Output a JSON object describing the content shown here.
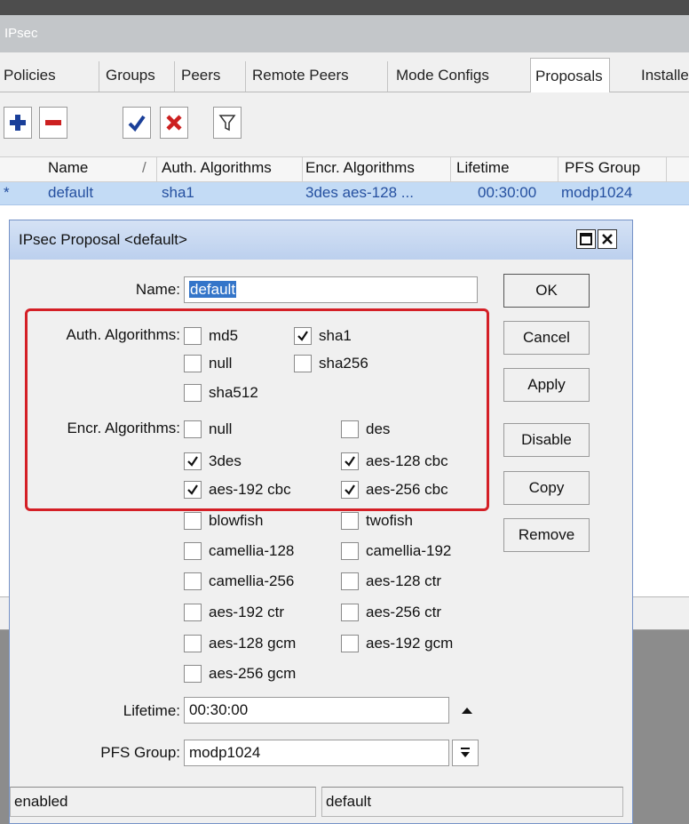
{
  "window": {
    "title": "IPsec"
  },
  "tabs": [
    {
      "label": "Policies"
    },
    {
      "label": "Groups"
    },
    {
      "label": "Peers"
    },
    {
      "label": "Remote Peers"
    },
    {
      "label": "Mode Configs"
    },
    {
      "label": "Proposals"
    },
    {
      "label": "Installe"
    }
  ],
  "active_tab": "Proposals",
  "table": {
    "columns": [
      "Name",
      "Auth. Algorithms",
      "Encr. Algorithms",
      "Lifetime",
      "PFS Group"
    ],
    "sort_marker": "/",
    "rows": [
      {
        "marker": "*",
        "name": "default",
        "auth": "sha1",
        "encr": "3des aes-128 ...",
        "lifetime": "00:30:00",
        "pfs": "modp1024"
      }
    ]
  },
  "dialog": {
    "title": "IPsec Proposal <default>",
    "name_label": "Name:",
    "name_value": "default",
    "auth_label": "Auth. Algorithms:",
    "auth": [
      {
        "label": "md5",
        "checked": false
      },
      {
        "label": "sha1",
        "checked": true
      },
      {
        "label": "null",
        "checked": false
      },
      {
        "label": "sha256",
        "checked": false
      },
      {
        "label": "sha512",
        "checked": false
      }
    ],
    "encr_label": "Encr. Algorithms:",
    "encr": [
      {
        "label": "null",
        "checked": false
      },
      {
        "label": "des",
        "checked": false
      },
      {
        "label": "3des",
        "checked": true
      },
      {
        "label": "aes-128 cbc",
        "checked": true
      },
      {
        "label": "aes-192 cbc",
        "checked": true
      },
      {
        "label": "aes-256 cbc",
        "checked": true
      },
      {
        "label": "blowfish",
        "checked": false
      },
      {
        "label": "twofish",
        "checked": false
      },
      {
        "label": "camellia-128",
        "checked": false
      },
      {
        "label": "camellia-192",
        "checked": false
      },
      {
        "label": "camellia-256",
        "checked": false
      },
      {
        "label": "aes-128 ctr",
        "checked": false
      },
      {
        "label": "aes-192 ctr",
        "checked": false
      },
      {
        "label": "aes-256 ctr",
        "checked": false
      },
      {
        "label": "aes-128 gcm",
        "checked": false
      },
      {
        "label": "aes-192 gcm",
        "checked": false
      },
      {
        "label": "aes-256 gcm",
        "checked": false
      }
    ],
    "lifetime_label": "Lifetime:",
    "lifetime_value": "00:30:00",
    "pfs_label": "PFS Group:",
    "pfs_value": "modp1024",
    "buttons": {
      "ok": "OK",
      "cancel": "Cancel",
      "apply": "Apply",
      "disable": "Disable",
      "copy": "Copy",
      "remove": "Remove"
    },
    "status": {
      "left": "enabled",
      "right": "default"
    }
  },
  "colors": {
    "highlight_box": "#d41f26",
    "selection_row": "#c3dbf5",
    "add_icon": "#1a3f99",
    "remove_icon": "#cc2020",
    "enable_icon": "#1a3f99",
    "disable_icon": "#cc2020"
  },
  "icons": [
    "add-icon",
    "remove-icon",
    "enable-icon",
    "disable-icon",
    "filter-icon",
    "maximize-icon",
    "close-icon",
    "spin-up-icon",
    "dropdown-icon"
  ]
}
